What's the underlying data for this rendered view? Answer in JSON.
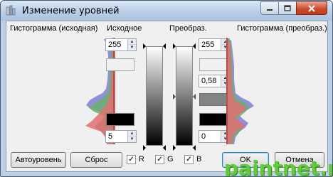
{
  "window": {
    "title": "Изменение уровней",
    "buttons": [
      "minimize",
      "maximize",
      "close"
    ]
  },
  "labels": {
    "hist_input": "Гистограмма (исходная)",
    "input": "Исходное",
    "output": "Преобраз.",
    "hist_output": "Гистограмма (преобраз.)"
  },
  "input": {
    "high": "255",
    "low": "5"
  },
  "output": {
    "high": "255",
    "gamma": "0,58",
    "low": "0"
  },
  "buttons": {
    "auto": "Автоуровень",
    "reset": "Сброс",
    "ok": "OK",
    "cancel": "Отмена"
  },
  "channels": [
    {
      "label": "R",
      "checked": true
    },
    {
      "label": "G",
      "checked": true
    },
    {
      "label": "B",
      "checked": true
    }
  ],
  "colors": {
    "red": "#e07070",
    "green": "#6fae6f",
    "blue": "#7f7fd6"
  },
  "watermark": "paintnet.ru"
}
